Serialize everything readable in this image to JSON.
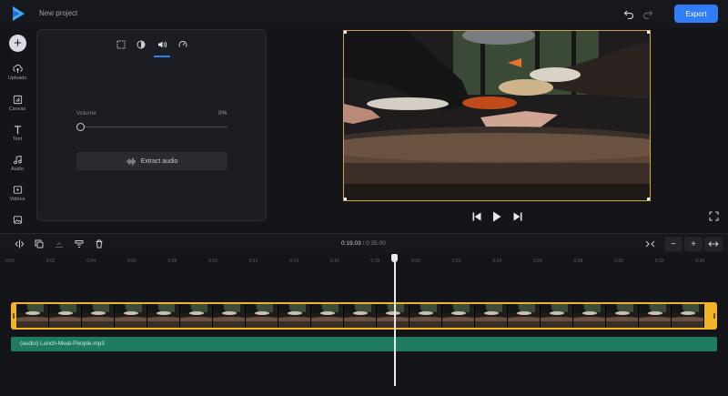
{
  "app": {
    "project_title": "New project",
    "export_label": "Export"
  },
  "sidebar": {
    "items": [
      {
        "label": "Uploads",
        "icon": "upload-icon"
      },
      {
        "label": "Canvas",
        "icon": "canvas-icon"
      },
      {
        "label": "Text",
        "icon": "text-icon"
      },
      {
        "label": "Audio",
        "icon": "music-note-icon"
      },
      {
        "label": "Videos",
        "icon": "video-icon"
      },
      {
        "label": "",
        "icon": "image-icon"
      }
    ]
  },
  "panel": {
    "tabs": [
      "crop-icon",
      "contrast-icon",
      "volume-icon",
      "speed-icon"
    ],
    "active_tab": "volume-icon",
    "volume_label": "Volume",
    "volume_value": "0%",
    "volume_level": 0,
    "extract_audio_label": "Extract audio"
  },
  "timeline": {
    "current_time": "0:19.03",
    "separator": "/",
    "total_time": "0:35.00",
    "ticks": [
      "0:00",
      "0:02",
      "0:04",
      "0:06",
      "0:08",
      "0:10",
      "0:12",
      "0:14",
      "0:16",
      "0:18",
      "0:20",
      "0:22",
      "0:24",
      "0:26",
      "0:28",
      "0:30",
      "0:32",
      "0:34"
    ],
    "audio_clip_label": "(audio) Lunch-Meal-People.mp3"
  },
  "colors": {
    "accent": "#2f7df7",
    "video_clip": "#f0b429",
    "audio_clip": "#1f7a63"
  }
}
